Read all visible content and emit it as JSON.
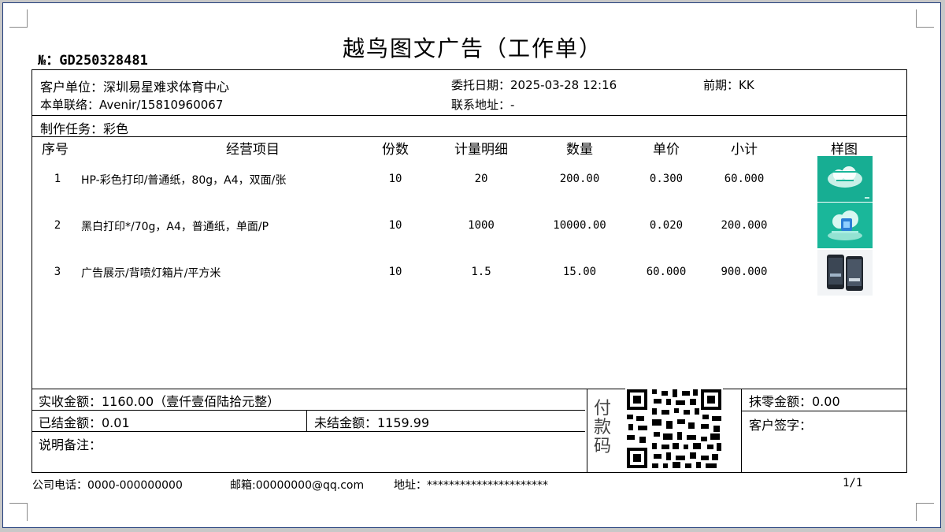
{
  "title": "越鸟图文广告（工作单）",
  "order_no": "№：GD250328481",
  "header": {
    "customer": "客户单位：深圳易星难求体育中心",
    "contact": "本单联络：Avenir/15810960067",
    "date": "委托日期：2025-03-28 12:16",
    "front": "前期：KK",
    "address": "联系地址：-",
    "task": "制作任务：彩色"
  },
  "columns": [
    "序号",
    "经营项目",
    "份数",
    "计量明细",
    "数量",
    "单价",
    "小计",
    "样图"
  ],
  "rows": [
    {
      "no": "1",
      "item": "HP-彩色打印/普通纸，80g，A4，双面/张",
      "copies": "10",
      "detail": "20",
      "qty": "200.00",
      "price": "0.300",
      "subtotal": "60.000",
      "thumb": "thumb-cloud-teal"
    },
    {
      "no": "2",
      "item": "黑白打印*/70g，A4，普通纸，单面/P",
      "copies": "10",
      "detail": "1000",
      "qty": "10000.00",
      "price": "0.020",
      "subtotal": "200.000",
      "thumb": "thumb-cloud-device"
    },
    {
      "no": "3",
      "item": "广告展示/背喷灯箱片/平方米",
      "copies": "10",
      "detail": "1.5",
      "qty": "15.00",
      "price": "60.000",
      "subtotal": "900.000",
      "thumb": "thumb-phones"
    }
  ],
  "summary": {
    "received": "实收金额：1160.00（壹仟壹佰陆拾元整）",
    "settled": "已结金额：0.01",
    "unsettled": "未结金额：1159.99",
    "remark": "说明备注：",
    "pay_code": [
      "付",
      "款",
      "码"
    ],
    "rounding": "抹零金额：0.00",
    "signature": "客户签字："
  },
  "footer": {
    "phone": "公司电话：0000-000000000",
    "email": "邮箱:00000000@qq.com",
    "address": "地址：**********************",
    "page": "1/1"
  },
  "colors": {
    "frame": "#1e3a7a",
    "thumb_teal": "#1ab79a",
    "thumb_dark": "#20262e"
  }
}
